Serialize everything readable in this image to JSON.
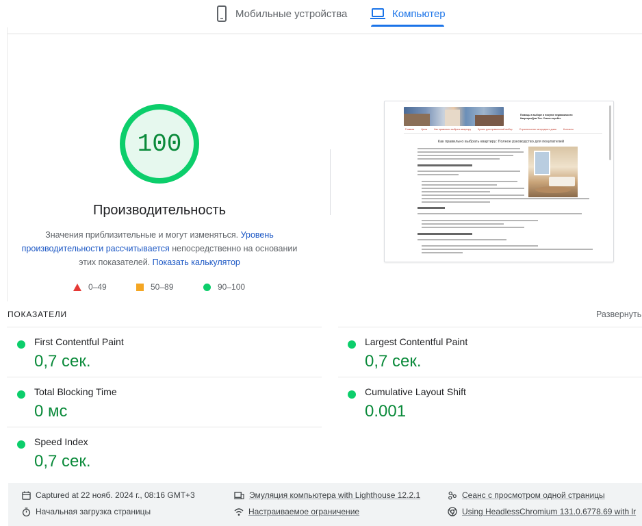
{
  "tabs": {
    "mobile": "Мобильные устройства",
    "desktop": "Компьютер",
    "active": "desktop"
  },
  "gauge": {
    "score": "100",
    "score_value": 100,
    "title": "Производительность",
    "desc_prefix": "Значения приблизительные и могут изменяться. ",
    "desc_link": "Уровень производительности рассчитывается",
    "desc_middle": " непосредственно на основании этих показателей. ",
    "calc_link": "Показать калькулятор"
  },
  "legend": {
    "fail": "0–49",
    "average": "50–89",
    "pass": "90–100"
  },
  "screenshot": {
    "site_title": "Помощь в выборе и покупке недвижимости КвартирыДом.Топ. Сказы перейть",
    "nav": [
      "Главная",
      "Цены",
      "Как правильно выбрать квартиру",
      "Купить дом правильный выбор",
      "Строительство загородного дома",
      "Контакты"
    ],
    "article_title": "Как правильно выбрать квартиру: Полное руководство для покупателей"
  },
  "metrics": {
    "section_label": "ПОКАЗАТЕЛИ",
    "expand": "Развернуть",
    "items": [
      {
        "name": "First Contentful Paint",
        "value": "0,7 сек."
      },
      {
        "name": "Largest Contentful Paint",
        "value": "0,7 сек."
      },
      {
        "name": "Total Blocking Time",
        "value": "0 мс"
      },
      {
        "name": "Cumulative Layout Shift",
        "value": "0.001"
      },
      {
        "name": "Speed Index",
        "value": "0,7 сек."
      }
    ]
  },
  "footer": {
    "captured": "Captured at 22 нояб. 2024 г., 08:16 GMT+3",
    "initial_load": "Начальная загрузка страницы",
    "emulation": "Эмуляция компьютера with Lighthouse 12.2.1",
    "throttling": "Настраиваемое ограничение",
    "session": "Сеанс с просмотром одной страницы",
    "browser": "Using HeadlessChromium 131.0.6778.69 with lr"
  },
  "colors": {
    "pass": "#0cce6b",
    "pass_text": "#0a8a3a",
    "average": "#f4a623",
    "fail": "#e53935",
    "accent": "#1a73e8"
  }
}
